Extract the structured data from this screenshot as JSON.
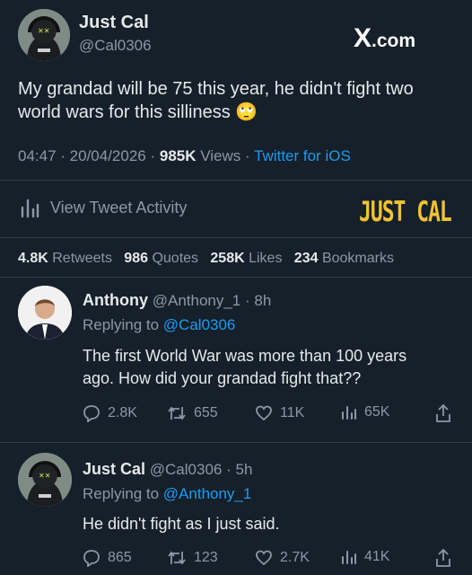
{
  "tweet": {
    "author_name": "Just Cal",
    "author_handle": "@Cal0306",
    "brand_x": "X",
    "brand_domain": ".com",
    "text_line1": "My grandad will be 75 this year, he didn't fight two",
    "text_line2": "world wars for this silliness",
    "emoji": "🙄",
    "time": "04:47",
    "date": "20/04/2026",
    "views_count": "985K",
    "views_label": "Views",
    "client": "Twitter for iOS",
    "activity_label": "View Tweet Activity",
    "watermark": "JUST CAL",
    "stats": {
      "retweets_count": "4.8K",
      "retweets_label": "Retweets",
      "quotes_count": "986",
      "quotes_label": "Quotes",
      "likes_count": "258K",
      "likes_label": "Likes",
      "bookmarks_count": "234",
      "bookmarks_label": "Bookmarks"
    }
  },
  "replies": [
    {
      "name": "Anthony",
      "handle": "@Anthony_1",
      "age": "8h",
      "replying_label": "Replying to",
      "replying_to": "@Cal0306",
      "line1": "The first World War was more than 100 years",
      "line2": "ago. How did your grandad fight that??",
      "replies": "2.8K",
      "retweets": "655",
      "likes": "11K",
      "views": "65K"
    },
    {
      "name": "Just Cal",
      "handle": "@Cal0306",
      "age": "5h",
      "replying_label": "Replying to",
      "replying_to": "@Anthony_1",
      "line1": "He didn't fight as I just said.",
      "line2": "",
      "replies": "865",
      "retweets": "123",
      "likes": "2.7K",
      "views": "41K"
    }
  ],
  "colors": {
    "background": "#15202b",
    "text": "#e7e9ea",
    "muted": "#8b98a5",
    "link": "#1d9bf0",
    "watermark": "#f2c230"
  }
}
